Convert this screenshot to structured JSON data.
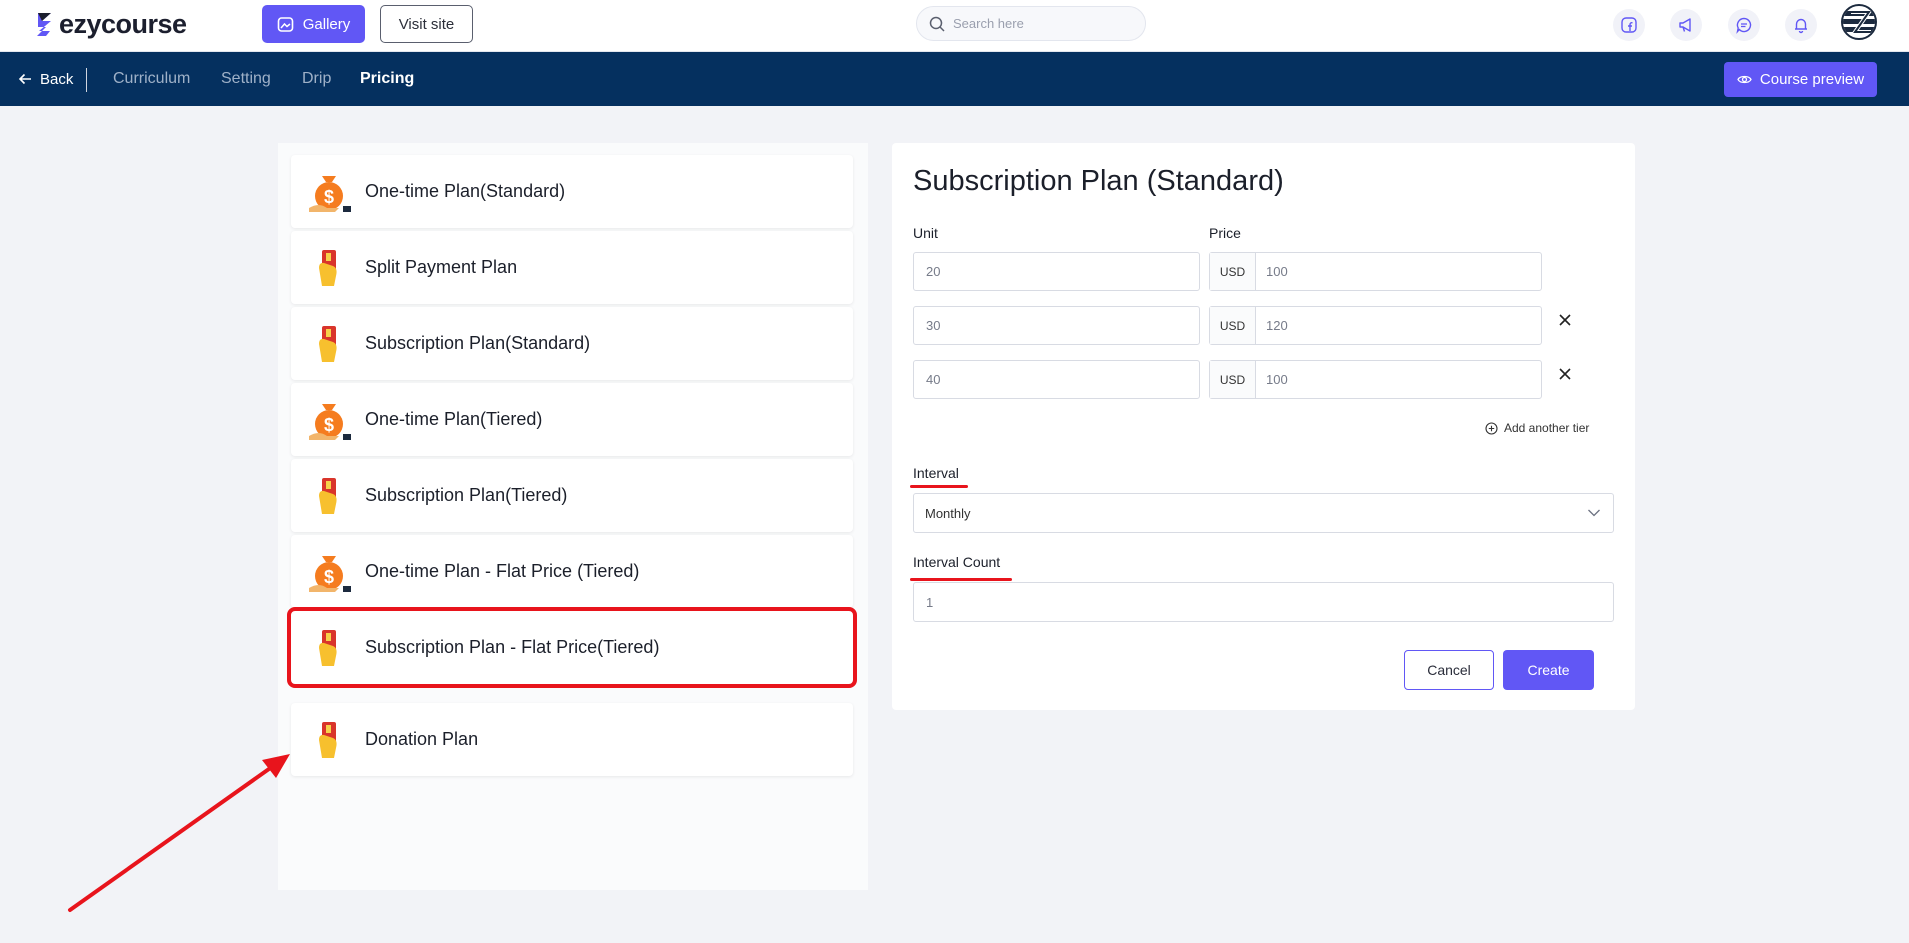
{
  "brand": {
    "name": "ezycourse"
  },
  "header": {
    "gallery_label": "Gallery",
    "visit_site_label": "Visit site",
    "search_placeholder": "Search here",
    "icons": [
      "facebook-icon",
      "megaphone-icon",
      "chat-icon",
      "bell-icon"
    ]
  },
  "subnav": {
    "back_label": "Back",
    "tabs": [
      {
        "label": "Curriculum",
        "active": false
      },
      {
        "label": "Setting",
        "active": false
      },
      {
        "label": "Drip",
        "active": false
      },
      {
        "label": "Pricing",
        "active": true
      }
    ],
    "preview_label": "Course preview"
  },
  "plans": [
    {
      "label": "One-time Plan(Standard)",
      "icon": "money-bag-icon"
    },
    {
      "label": "Split Payment Plan",
      "icon": "card-hand-icon"
    },
    {
      "label": "Subscription Plan(Standard)",
      "icon": "card-hand-icon"
    },
    {
      "label": "One-time Plan(Tiered)",
      "icon": "money-bag-icon"
    },
    {
      "label": "Subscription Plan(Tiered)",
      "icon": "card-hand-icon"
    },
    {
      "label": "One-time Plan - Flat Price (Tiered)",
      "icon": "money-bag-icon"
    },
    {
      "label": "Subscription Plan - Flat Price(Tiered)",
      "icon": "card-hand-icon",
      "highlighted": true
    },
    {
      "label": "Donation Plan",
      "icon": "card-hand-icon"
    }
  ],
  "form": {
    "title": "Subscription Plan (Standard)",
    "unit_label": "Unit",
    "price_label": "Price",
    "tiers": [
      {
        "unit": "20",
        "currency": "USD",
        "price": "100"
      },
      {
        "unit": "30",
        "currency": "USD",
        "price": "120"
      },
      {
        "unit": "40",
        "currency": "USD",
        "price": "100"
      }
    ],
    "add_tier_label": "Add another tier",
    "interval_label": "Interval",
    "interval_value": "Monthly",
    "interval_count_label": "Interval Count",
    "interval_count_value": "1",
    "cancel_label": "Cancel",
    "create_label": "Create"
  },
  "colors": {
    "accent": "#6157f5",
    "navy": "#05305f",
    "annotation_red": "#e8141c"
  }
}
